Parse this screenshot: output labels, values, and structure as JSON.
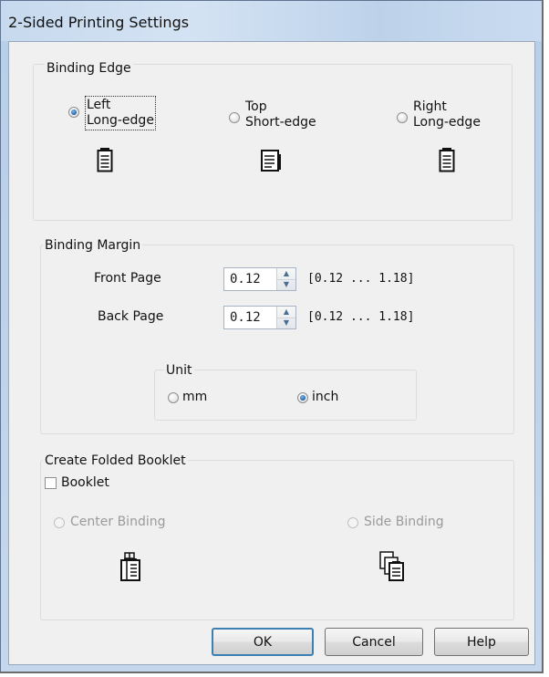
{
  "window": {
    "title": "2-Sided Printing Settings"
  },
  "binding_edge": {
    "label": "Binding Edge",
    "options": [
      {
        "line1": "Left",
        "line2": "Long-edge",
        "selected": true,
        "icon": "document-left-binding-icon"
      },
      {
        "line1": "Top",
        "line2": "Short-edge",
        "selected": false,
        "icon": "document-top-binding-icon"
      },
      {
        "line1": "Right",
        "line2": "Long-edge",
        "selected": false,
        "icon": "document-right-binding-icon"
      }
    ]
  },
  "binding_margin": {
    "label": "Binding Margin",
    "front": {
      "label": "Front Page",
      "value": "0.12",
      "range": "[0.12 ... 1.18]"
    },
    "back": {
      "label": "Back Page",
      "value": "0.12",
      "range": "[0.12 ... 1.18]"
    },
    "unit": {
      "label": "Unit",
      "options": [
        {
          "label": "mm",
          "selected": false
        },
        {
          "label": "inch",
          "selected": true
        }
      ]
    }
  },
  "booklet": {
    "label": "Create Folded Booklet",
    "checkbox_label": "Booklet",
    "checked": false,
    "options": [
      {
        "label": "Center Binding",
        "enabled": false,
        "icon": "booklet-center-binding-icon"
      },
      {
        "label": "Side Binding",
        "enabled": false,
        "icon": "booklet-side-binding-icon"
      }
    ]
  },
  "buttons": {
    "ok": "OK",
    "cancel": "Cancel",
    "help": "Help"
  },
  "colors": {
    "accent": "#1f5fa6",
    "window_frame": "#c4d7ec",
    "dialog_bg": "#f0f0f0"
  }
}
